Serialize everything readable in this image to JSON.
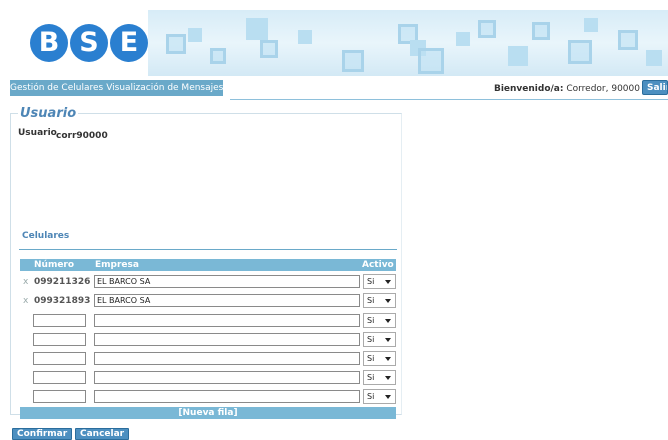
{
  "logo": {
    "letters": [
      "B",
      "S",
      "E"
    ]
  },
  "menu": {
    "items": [
      "Gestión de Celulares",
      "Visualización de Mensajes"
    ]
  },
  "welcome": {
    "label": "Bienvenido/a:",
    "user": "Corredor, 90000"
  },
  "exit_button": "Salir",
  "section": {
    "legend": "Usuario",
    "user_label": "Usuario",
    "user_value": "corr90000"
  },
  "cellphones": {
    "title": "Celulares",
    "columns": {
      "number": "Número",
      "company": "Empresa",
      "active": "Activo"
    },
    "rows": [
      {
        "delete": "x",
        "number": "099211326",
        "company": "EL BARCO SA",
        "active": "Si"
      },
      {
        "delete": "x",
        "number": "099321893",
        "company": "EL BARCO SA",
        "active": "Si"
      },
      {
        "number": "",
        "company": "",
        "active": "Si"
      },
      {
        "number": "",
        "company": "",
        "active": "Si"
      },
      {
        "number": "",
        "company": "",
        "active": "Si"
      },
      {
        "number": "",
        "company": "",
        "active": "Si"
      },
      {
        "number": "",
        "company": "",
        "active": "Si"
      }
    ],
    "new_row": "[Nueva fila]"
  },
  "buttons": {
    "confirm": "Confirmar",
    "cancel": "Cancelar"
  },
  "colors": {
    "brand": "#2a7fd0",
    "header_blue": "#7ab8d6",
    "menu_blue": "#6aa9c9",
    "legend_blue": "#4e86b6"
  }
}
